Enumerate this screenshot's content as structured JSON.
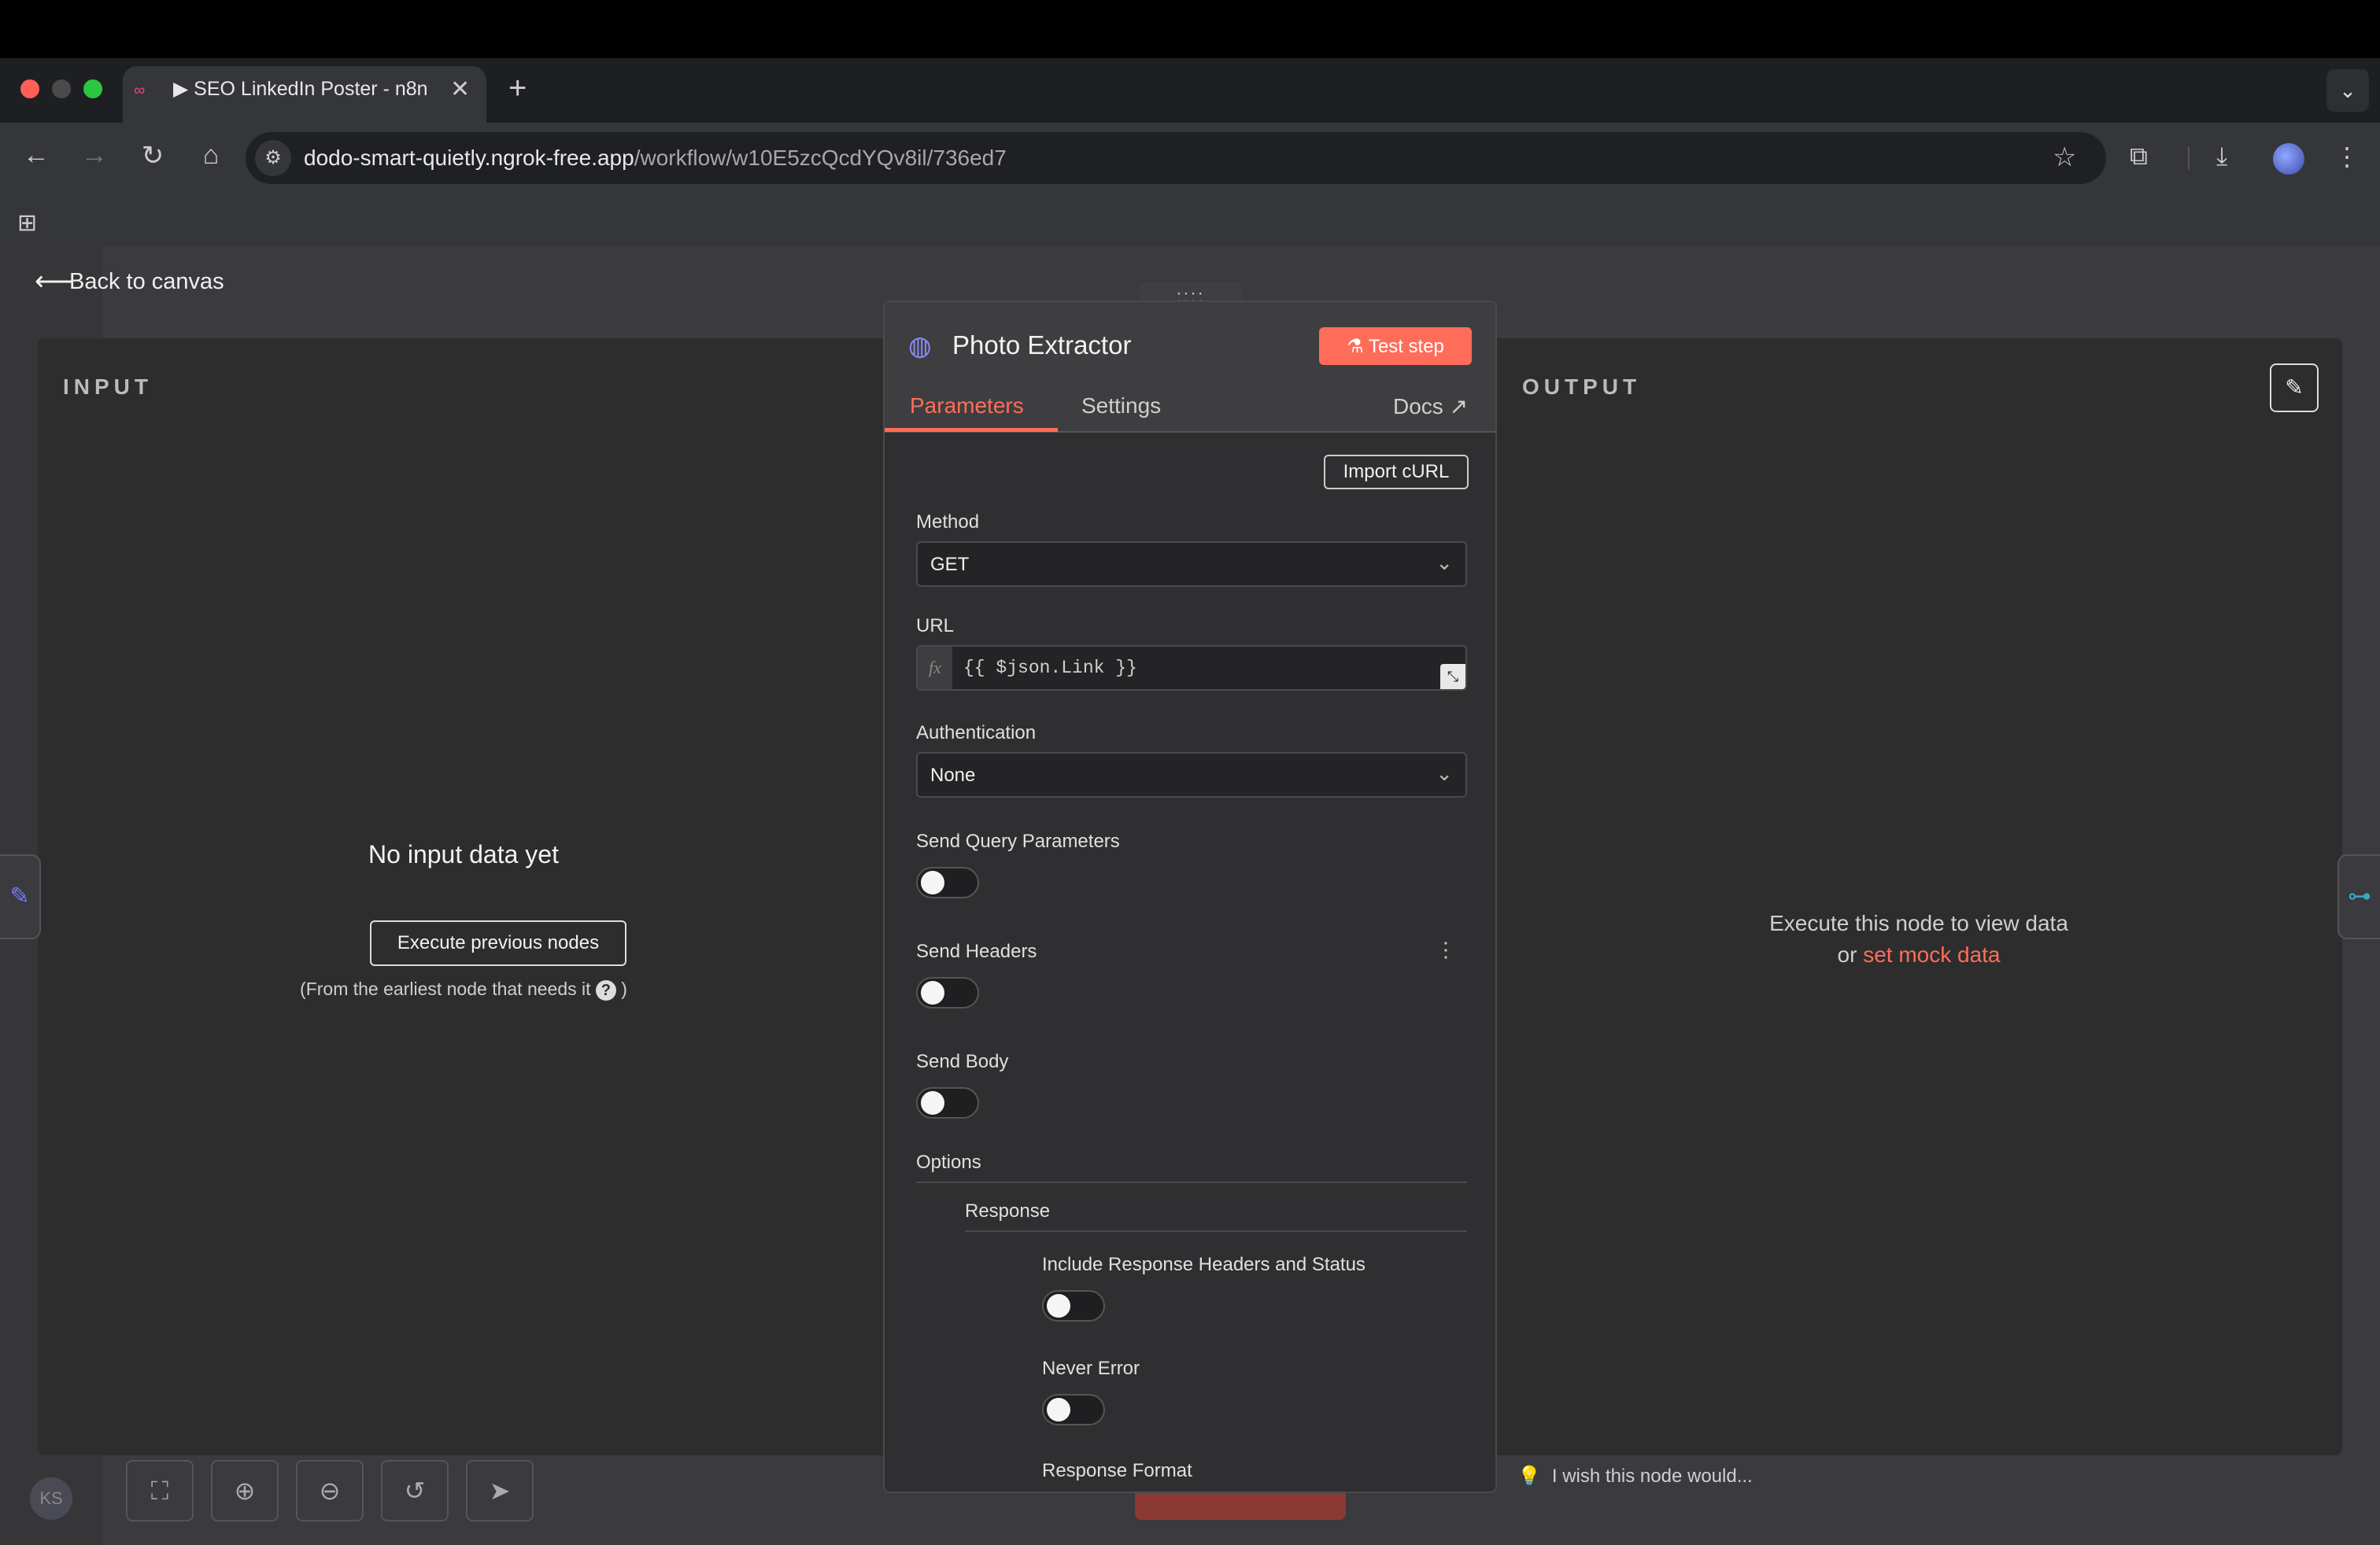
{
  "browser": {
    "tab_title": "▶ SEO LinkedIn Poster - n8n",
    "close_glyph": "✕",
    "new_tab_glyph": "+",
    "url_host": "dodo-smart-quietly.ngrok-free.app",
    "url_path": "/workflow/w10E5zcQcdYQv8il/736ed7"
  },
  "nav": {
    "back_to_canvas": "Back to canvas"
  },
  "input_panel": {
    "label": "INPUT",
    "no_data_title": "No input data yet",
    "execute_button": "Execute previous nodes",
    "hint_prefix": "(From the earliest node that needs it",
    "hint_suffix": ")"
  },
  "output_panel": {
    "label": "OUTPUT",
    "message_line1": "Execute this node to view data",
    "message_or": "or",
    "mock_link": "set mock data"
  },
  "node": {
    "title": "Photo Extractor",
    "test_step": "Test step",
    "tabs": {
      "parameters": "Parameters",
      "settings": "Settings",
      "docs": "Docs"
    },
    "import_curl": "Import cURL",
    "method_label": "Method",
    "method_value": "GET",
    "url_label": "URL",
    "url_fx": "fx",
    "url_value": "{{ $json.Link }}",
    "auth_label": "Authentication",
    "auth_value": "None",
    "send_query_label": "Send Query Parameters",
    "send_query_on": false,
    "send_headers_label": "Send Headers",
    "send_headers_on": false,
    "send_body_label": "Send Body",
    "send_body_on": false,
    "options_label": "Options",
    "response_label": "Response",
    "include_headers_label": "Include Response Headers and Status",
    "include_headers_on": false,
    "never_error_label": "Never Error",
    "never_error_on": false,
    "response_format_label": "Response Format"
  },
  "footer": {
    "wish": "I wish this node would...",
    "avatar_initials": "KS"
  },
  "colors": {
    "accent": "#ff6d5a",
    "panel": "#2d2d2d",
    "background": "#3a3a3f"
  }
}
